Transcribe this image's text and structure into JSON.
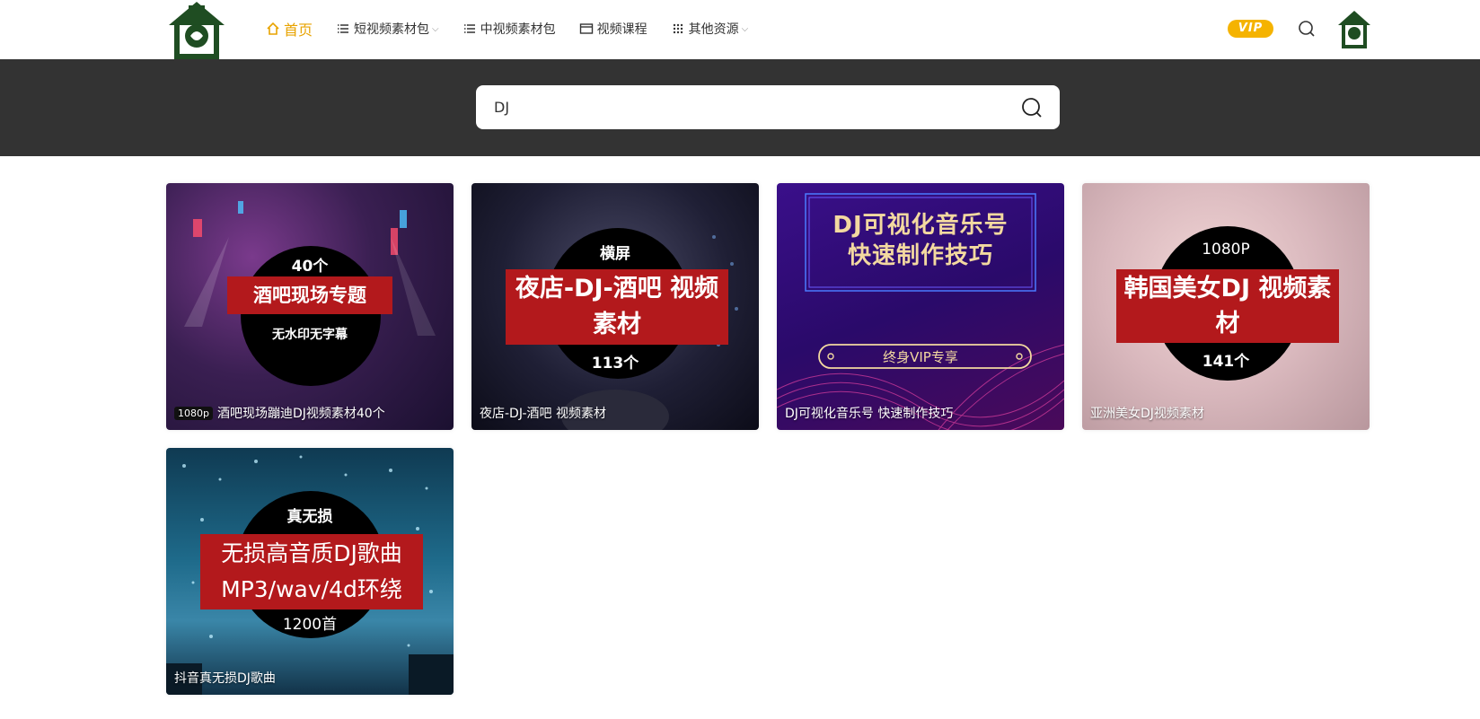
{
  "nav": {
    "items": [
      {
        "label": "首页",
        "active": true,
        "icon": "home-icon"
      },
      {
        "label": "短视频素材包",
        "dropdown": true,
        "icon": "list-icon"
      },
      {
        "label": "中视频素材包",
        "icon": "list-icon"
      },
      {
        "label": "视频课程",
        "icon": "window-icon"
      },
      {
        "label": "其他资源",
        "dropdown": true,
        "icon": "grid-icon"
      }
    ],
    "vip_label": "VIP"
  },
  "search": {
    "value": "DJ"
  },
  "colors": {
    "accent": "#e8a300",
    "vip": "#f5b300",
    "banner_red": "#b3191c",
    "band": "#333333"
  },
  "cards": [
    {
      "top": "40个",
      "banner": "酒吧现场专题",
      "bottom": "无水印无字幕",
      "badge": "1080p",
      "caption": "酒吧现场蹦迪DJ视频素材40个"
    },
    {
      "top": "横屏",
      "banner": "夜店-DJ-酒吧 视频素材",
      "bottom": "113个",
      "caption": "夜店-DJ-酒吧 视频素材"
    },
    {
      "title_line1": "DJ可视化音乐号",
      "title_line2": "快速制作技巧",
      "pill": "终身VIP专享",
      "caption": "DJ可视化音乐号 快速制作技巧"
    },
    {
      "top": "1080P",
      "banner": "韩国美女DJ 视频素材",
      "bottom": "141个",
      "caption": "亚洲美女DJ视频素材"
    },
    {
      "top": "真无损",
      "banner_line1": "无损高音质DJ歌曲",
      "banner_line2": "MP3/wav/4d环绕",
      "bottom": "1200首",
      "caption": "抖音真无损DJ歌曲"
    }
  ]
}
